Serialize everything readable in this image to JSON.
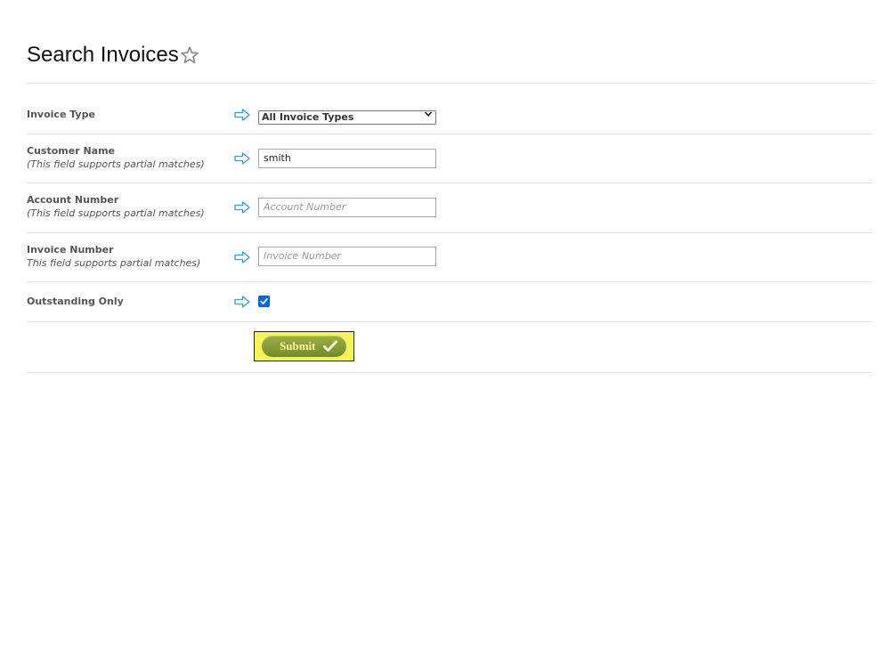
{
  "page": {
    "title": "Search Invoices",
    "favorite_icon": "star-outline-icon"
  },
  "form": {
    "invoice_type": {
      "label": "Invoice Type",
      "selected": "All Invoice Types",
      "options": [
        "All Invoice Types"
      ]
    },
    "customer_name": {
      "label": "Customer Name",
      "hint": "(This field supports partial matches)",
      "value": "smith",
      "placeholder": ""
    },
    "account_number": {
      "label": "Account Number",
      "hint": "(This field supports partial matches)",
      "value": "",
      "placeholder": "Account Number"
    },
    "invoice_number": {
      "label": "Invoice Number",
      "hint": "This field supports partial matches)",
      "value": "",
      "placeholder": "Invoice Number"
    },
    "outstanding_only": {
      "label": "Outstanding Only",
      "checked": true
    },
    "submit": {
      "label": "Submit",
      "icon": "checkmark-icon"
    }
  },
  "colors": {
    "arrow": "#3a9ad9",
    "checkbox": "#0a66d9",
    "submit_bg": "#8aa23a",
    "submit_highlight": "#f5f35a",
    "submit_text": "#fbf7a6"
  }
}
